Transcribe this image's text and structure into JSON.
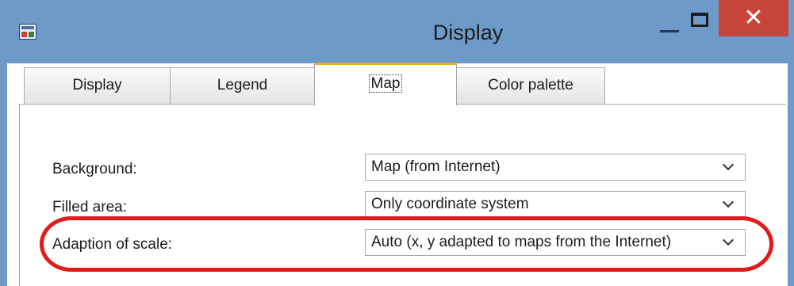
{
  "window": {
    "title": "Display",
    "icon": "app-window-icon",
    "close_glyph": "✕"
  },
  "tabs": [
    {
      "label": "Display",
      "active": false
    },
    {
      "label": "Legend",
      "active": false
    },
    {
      "label": "Map",
      "active": true
    },
    {
      "label": "Color palette",
      "active": false
    }
  ],
  "form": {
    "rows": [
      {
        "label": "Background:",
        "value": "Map (from Internet)"
      },
      {
        "label": "Filled area:",
        "value": "Only coordinate system"
      },
      {
        "label": "Adaption of scale:",
        "value": "Auto (x, y adapted to maps from the Internet)"
      }
    ]
  },
  "annotation": {
    "color": "#e01b1b",
    "target": "Adaption of scale"
  },
  "colors": {
    "titlebar": "#6d9ac9",
    "close": "#c7453b",
    "active_tab_accent": "#f0ae2c"
  }
}
